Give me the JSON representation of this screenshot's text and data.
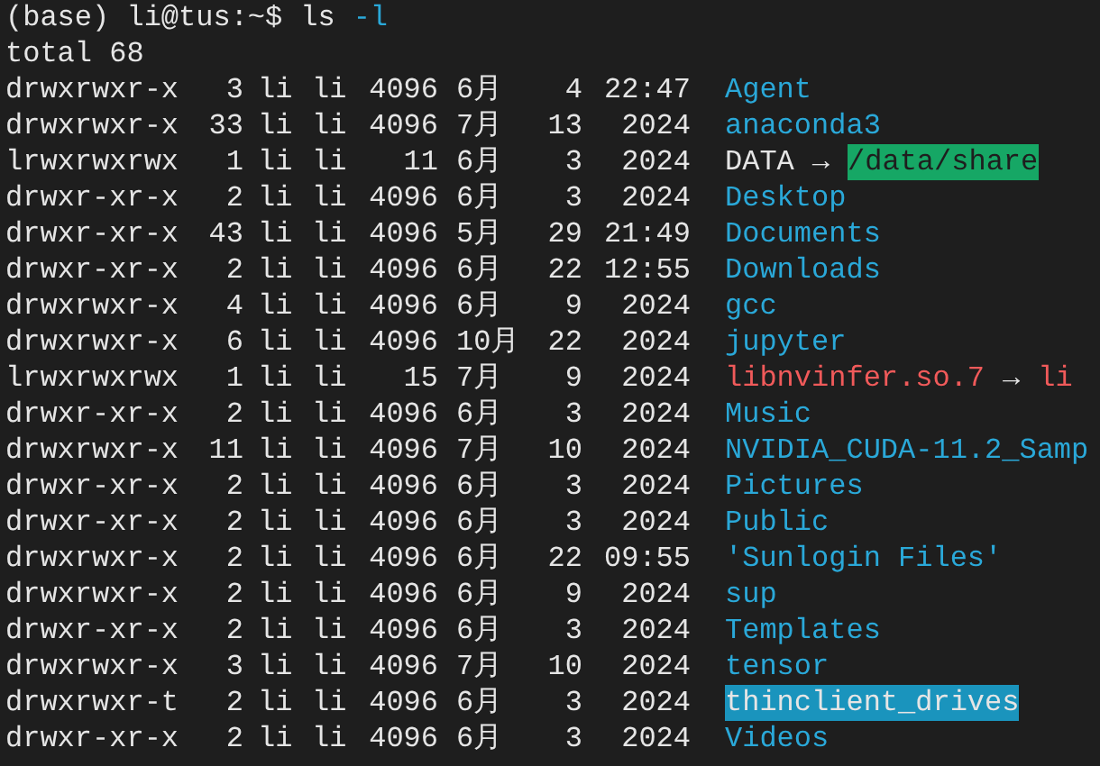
{
  "prompt": {
    "text": "(base) li@tus:~$",
    "command": "ls",
    "args": "-l"
  },
  "total": "total 68",
  "rows": [
    {
      "perms": "drwxrwxr-x",
      "links": "3",
      "owner": "li",
      "group": "li",
      "size": "4096",
      "month": "6月",
      "day": "4",
      "time": "22:47",
      "name": "Agent",
      "kind": "dir"
    },
    {
      "perms": "drwxrwxr-x",
      "links": "33",
      "owner": "li",
      "group": "li",
      "size": "4096",
      "month": "7月",
      "day": "13",
      "time": "2024",
      "name": "anaconda3",
      "kind": "dir"
    },
    {
      "perms": "lrwxrwxrwx",
      "links": "1",
      "owner": "li",
      "group": "li",
      "size": "11",
      "month": "6月",
      "day": "3",
      "time": "2024",
      "name": "DATA",
      "kind": "link",
      "arrow": "→",
      "target": {
        "text": "/data/share",
        "kind": "other_writable"
      }
    },
    {
      "perms": "drwxr-xr-x",
      "links": "2",
      "owner": "li",
      "group": "li",
      "size": "4096",
      "month": "6月",
      "day": "3",
      "time": "2024",
      "name": "Desktop",
      "kind": "dir"
    },
    {
      "perms": "drwxr-xr-x",
      "links": "43",
      "owner": "li",
      "group": "li",
      "size": "4096",
      "month": "5月",
      "day": "29",
      "time": "21:49",
      "name": "Documents",
      "kind": "dir"
    },
    {
      "perms": "drwxr-xr-x",
      "links": "2",
      "owner": "li",
      "group": "li",
      "size": "4096",
      "month": "6月",
      "day": "22",
      "time": "12:55",
      "name": "Downloads",
      "kind": "dir"
    },
    {
      "perms": "drwxrwxr-x",
      "links": "4",
      "owner": "li",
      "group": "li",
      "size": "4096",
      "month": "6月",
      "day": "9",
      "time": "2024",
      "name": "gcc",
      "kind": "dir"
    },
    {
      "perms": "drwxrwxr-x",
      "links": "6",
      "owner": "li",
      "group": "li",
      "size": "4096",
      "month": "10月",
      "day": "22",
      "time": "2024",
      "name": "jupyter",
      "kind": "dir"
    },
    {
      "perms": "lrwxrwxrwx",
      "links": "1",
      "owner": "li",
      "group": "li",
      "size": "15",
      "month": "7月",
      "day": "9",
      "time": "2024",
      "name": "libnvinfer.so.7",
      "kind": "broken_link",
      "arrow": "→",
      "target": {
        "text": "li",
        "kind": "broken_link"
      }
    },
    {
      "perms": "drwxr-xr-x",
      "links": "2",
      "owner": "li",
      "group": "li",
      "size": "4096",
      "month": "6月",
      "day": "3",
      "time": "2024",
      "name": "Music",
      "kind": "dir"
    },
    {
      "perms": "drwxrwxr-x",
      "links": "11",
      "owner": "li",
      "group": "li",
      "size": "4096",
      "month": "7月",
      "day": "10",
      "time": "2024",
      "name": "NVIDIA_CUDA-11.2_Samp",
      "kind": "dir"
    },
    {
      "perms": "drwxr-xr-x",
      "links": "2",
      "owner": "li",
      "group": "li",
      "size": "4096",
      "month": "6月",
      "day": "3",
      "time": "2024",
      "name": "Pictures",
      "kind": "dir"
    },
    {
      "perms": "drwxr-xr-x",
      "links": "2",
      "owner": "li",
      "group": "li",
      "size": "4096",
      "month": "6月",
      "day": "3",
      "time": "2024",
      "name": "Public",
      "kind": "dir"
    },
    {
      "perms": "drwxrwxr-x",
      "links": "2",
      "owner": "li",
      "group": "li",
      "size": "4096",
      "month": "6月",
      "day": "22",
      "time": "09:55",
      "name": "'Sunlogin Files'",
      "kind": "dir"
    },
    {
      "perms": "drwxrwxr-x",
      "links": "2",
      "owner": "li",
      "group": "li",
      "size": "4096",
      "month": "6月",
      "day": "9",
      "time": "2024",
      "name": "sup",
      "kind": "dir"
    },
    {
      "perms": "drwxr-xr-x",
      "links": "2",
      "owner": "li",
      "group": "li",
      "size": "4096",
      "month": "6月",
      "day": "3",
      "time": "2024",
      "name": "Templates",
      "kind": "dir"
    },
    {
      "perms": "drwxrwxr-x",
      "links": "3",
      "owner": "li",
      "group": "li",
      "size": "4096",
      "month": "7月",
      "day": "10",
      "time": "2024",
      "name": "tensor",
      "kind": "dir"
    },
    {
      "perms": "drwxrwxr-t",
      "links": "2",
      "owner": "li",
      "group": "li",
      "size": "4096",
      "month": "6月",
      "day": "3",
      "time": "2024",
      "name": "thinclient_drives",
      "kind": "sticky"
    },
    {
      "perms": "drwxr-xr-x",
      "links": "2",
      "owner": "li",
      "group": "li",
      "size": "4096",
      "month": "6月",
      "day": "3",
      "time": "2024",
      "name": "Videos",
      "kind": "dir"
    }
  ]
}
